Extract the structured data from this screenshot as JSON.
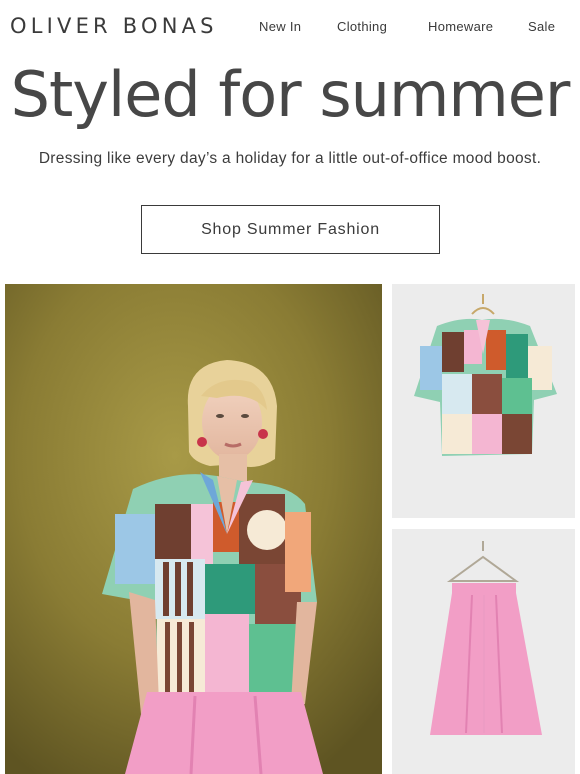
{
  "brand": {
    "logo_text": "OLIVER BONAS"
  },
  "nav": {
    "items": [
      {
        "label": "New In"
      },
      {
        "label": "Clothing"
      },
      {
        "label": "Homeware"
      },
      {
        "label": "Sale"
      }
    ]
  },
  "hero": {
    "headline": "Styled for summer",
    "subline": "Dressing like every day’s a holiday for a little out-of-office mood boost.",
    "cta_label": "Shop Summer Fashion"
  },
  "colors": {
    "text": "#3a3a3a",
    "backdrop_olive": "#8a7c34",
    "skirt_pink": "#f29ec6",
    "thumb_bg": "#ececec"
  }
}
